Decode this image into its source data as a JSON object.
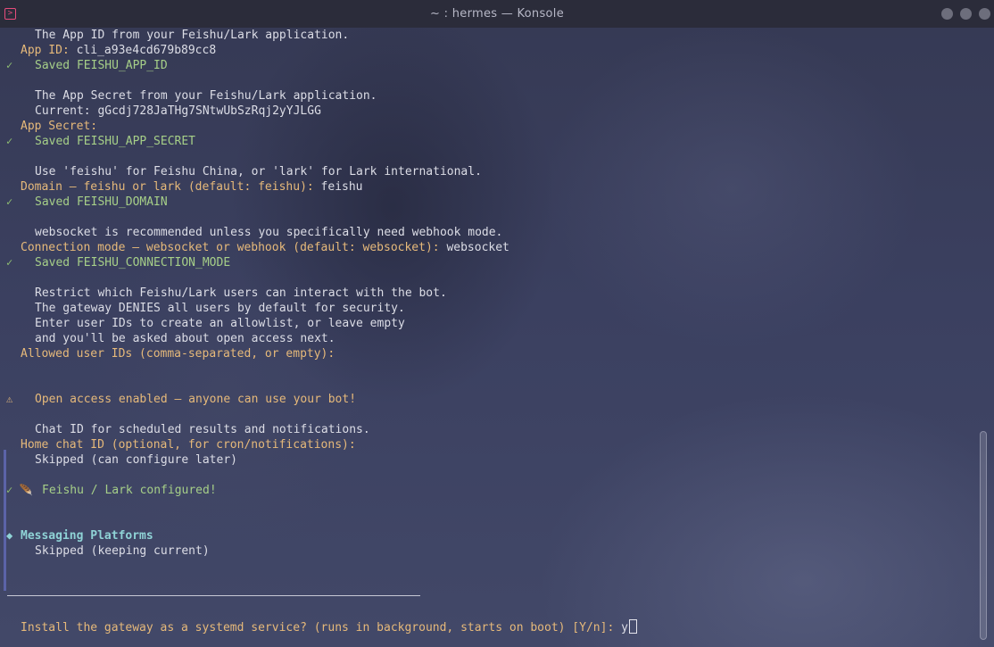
{
  "window": {
    "title": "~ : hermes — Konsole",
    "app_icon": "terminal-icon",
    "buttons": [
      "minimize",
      "maximize",
      "close"
    ]
  },
  "terminal": {
    "lines": [
      {
        "indent": 1,
        "kind": "plain",
        "mark": "",
        "text": "The App ID from your Feishu/Lark application."
      },
      {
        "indent": 0,
        "kind": "prompt",
        "mark": "",
        "text": "App ID: ",
        "value": "cli_a93e4cd679b89cc8"
      },
      {
        "indent": 1,
        "kind": "ok",
        "mark": "✓",
        "text": "Saved FEISHU_APP_ID"
      },
      {
        "indent": 1,
        "kind": "blank",
        "mark": "",
        "text": ""
      },
      {
        "indent": 1,
        "kind": "plain",
        "mark": "",
        "text": "The App Secret from your Feishu/Lark application."
      },
      {
        "indent": 1,
        "kind": "plain",
        "mark": "",
        "text": "Current: gGcdj728JaTHg7SNtwUbSzRqj2yYJLGG"
      },
      {
        "indent": 0,
        "kind": "prompt",
        "mark": "",
        "text": "App Secret:",
        "value": ""
      },
      {
        "indent": 1,
        "kind": "ok",
        "mark": "✓",
        "text": "Saved FEISHU_APP_SECRET"
      },
      {
        "indent": 1,
        "kind": "blank",
        "mark": "",
        "text": ""
      },
      {
        "indent": 1,
        "kind": "plain",
        "mark": "",
        "text": "Use 'feishu' for Feishu China, or 'lark' for Lark international."
      },
      {
        "indent": 0,
        "kind": "prompt",
        "mark": "",
        "text": "Domain — feishu or lark (default: feishu): ",
        "value": "feishu"
      },
      {
        "indent": 1,
        "kind": "ok",
        "mark": "✓",
        "text": "Saved FEISHU_DOMAIN"
      },
      {
        "indent": 1,
        "kind": "blank",
        "mark": "",
        "text": ""
      },
      {
        "indent": 1,
        "kind": "plain",
        "mark": "",
        "text": "websocket is recommended unless you specifically need webhook mode."
      },
      {
        "indent": 0,
        "kind": "prompt",
        "mark": "",
        "text": "Connection mode — websocket or webhook (default: websocket): ",
        "value": "websocket"
      },
      {
        "indent": 1,
        "kind": "ok",
        "mark": "✓",
        "text": "Saved FEISHU_CONNECTION_MODE"
      },
      {
        "indent": 1,
        "kind": "blank",
        "mark": "",
        "text": ""
      },
      {
        "indent": 1,
        "kind": "plain",
        "mark": "",
        "text": "Restrict which Feishu/Lark users can interact with the bot."
      },
      {
        "indent": 1,
        "kind": "plain",
        "mark": "",
        "text": "The gateway DENIES all users by default for security."
      },
      {
        "indent": 1,
        "kind": "plain",
        "mark": "",
        "text": "Enter user IDs to create an allowlist, or leave empty"
      },
      {
        "indent": 1,
        "kind": "plain",
        "mark": "",
        "text": "and you'll be asked about open access next."
      },
      {
        "indent": 0,
        "kind": "prompt",
        "mark": "",
        "text": "Allowed user IDs (comma-separated, or empty):",
        "value": ""
      },
      {
        "indent": 1,
        "kind": "blank",
        "mark": "",
        "text": ""
      },
      {
        "indent": 1,
        "kind": "blank",
        "mark": "",
        "text": ""
      },
      {
        "indent": 1,
        "kind": "warn",
        "mark": "⚠",
        "text": "Open access enabled — anyone can use your bot!"
      },
      {
        "indent": 1,
        "kind": "blank",
        "mark": "",
        "text": ""
      },
      {
        "indent": 1,
        "kind": "plain",
        "mark": "",
        "text": "Chat ID for scheduled results and notifications."
      },
      {
        "indent": 0,
        "kind": "prompt",
        "mark": "",
        "text": "Home chat ID (optional, for cron/notifications):",
        "value": ""
      },
      {
        "indent": 1,
        "kind": "plain",
        "mark": "",
        "text": "Skipped (can configure later)"
      },
      {
        "indent": 1,
        "kind": "blank",
        "mark": "",
        "text": ""
      },
      {
        "indent": 2,
        "kind": "ok",
        "mark": "✓ 🪶",
        "text": "Feishu / Lark configured!"
      },
      {
        "indent": 1,
        "kind": "blank",
        "mark": "",
        "text": ""
      },
      {
        "indent": 1,
        "kind": "blank",
        "mark": "",
        "text": ""
      },
      {
        "indent": 0,
        "kind": "section",
        "mark": "◆",
        "text": "Messaging Platforms"
      },
      {
        "indent": 1,
        "kind": "plain",
        "mark": "",
        "text": "Skipped (keeping current)"
      }
    ],
    "final_prompt": {
      "text": "Install the gateway as a systemd service? (runs in background, starts on boot) [Y/n]: ",
      "value": "y"
    }
  }
}
